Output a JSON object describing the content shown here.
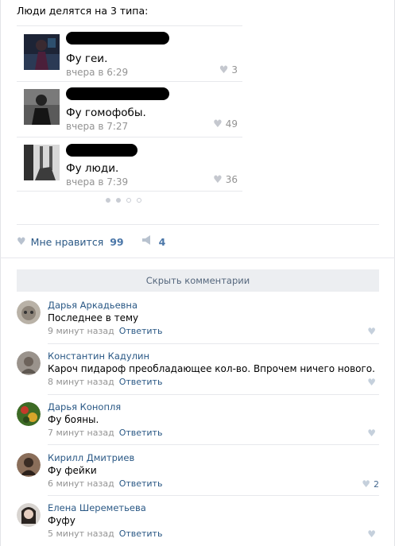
{
  "post": {
    "text": "Люди делятся на 3 типа:"
  },
  "cards": [
    {
      "message": "Фу геи.",
      "time": "вчера в 6:29",
      "likes": "3"
    },
    {
      "message": "Фу гомофобы.",
      "time": "вчера в 7:27",
      "likes": "49"
    },
    {
      "message": "Фу люди.",
      "time": "вчера в 7:39",
      "likes": "36"
    }
  ],
  "pager": {
    "total": 4,
    "active": 2
  },
  "actions": {
    "like_label": "Мне нравится",
    "like_count": "99",
    "share_count": "4"
  },
  "hide_comments_label": "Скрыть комментарии",
  "comments": [
    {
      "author": "Дарья Аркадьевна",
      "text": "Последнее в тему",
      "time": "9 минут назад",
      "reply": "Ответить",
      "likes": ""
    },
    {
      "author": "Константин Кадулин",
      "text": "Кароч пидароф преобладающее кол-во. Впрочем ничего нового.",
      "time": "8 минут назад",
      "reply": "Ответить",
      "likes": ""
    },
    {
      "author": "Дарья Конопля",
      "text": "Фу бояны.",
      "time": "7 минут назад",
      "reply": "Ответить",
      "likes": ""
    },
    {
      "author": "Кирилл Дмитриев",
      "text": "Фу фейки",
      "time": "6 минут назад",
      "reply": "Ответить",
      "likes": "2"
    },
    {
      "author": "Елена Шереметьева",
      "text": "Фуфу",
      "time": "5 минут назад",
      "reply": "Ответить",
      "likes": ""
    }
  ]
}
